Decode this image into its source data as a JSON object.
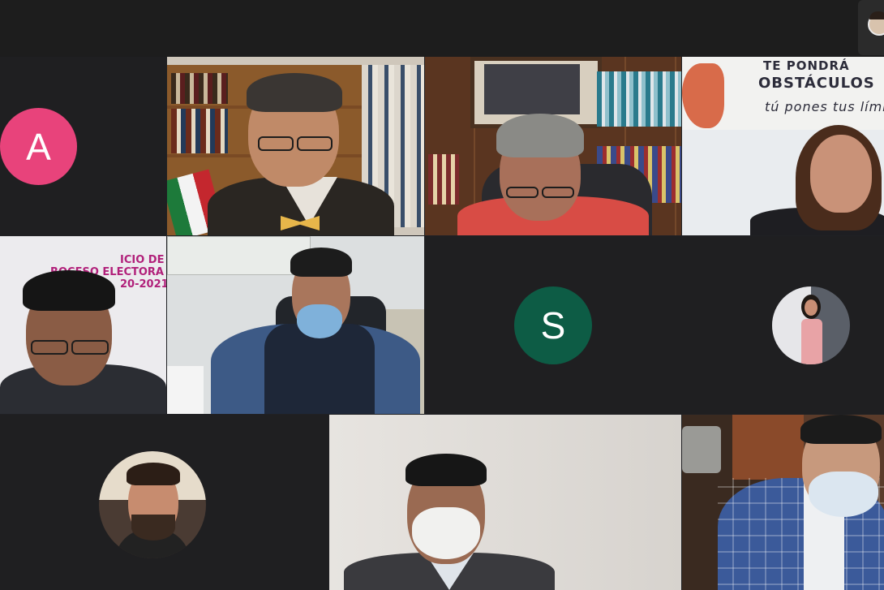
{
  "meeting": {
    "participants": [
      {
        "tile": "a",
        "avatar_letter": "A",
        "avatar_color": "#e8437b"
      },
      {
        "tile": "s",
        "avatar_letter": "S",
        "avatar_color": "#0d5c45"
      }
    ]
  },
  "wall_poster": {
    "line1": "TE PONDRÁ",
    "line2": "OBSTÁCULOS",
    "line3": "tú pones tus lími"
  },
  "background_banner": {
    "line1": "ICIO DE",
    "line2": "ROCESO ELECTORA",
    "line3": "20-2021"
  }
}
